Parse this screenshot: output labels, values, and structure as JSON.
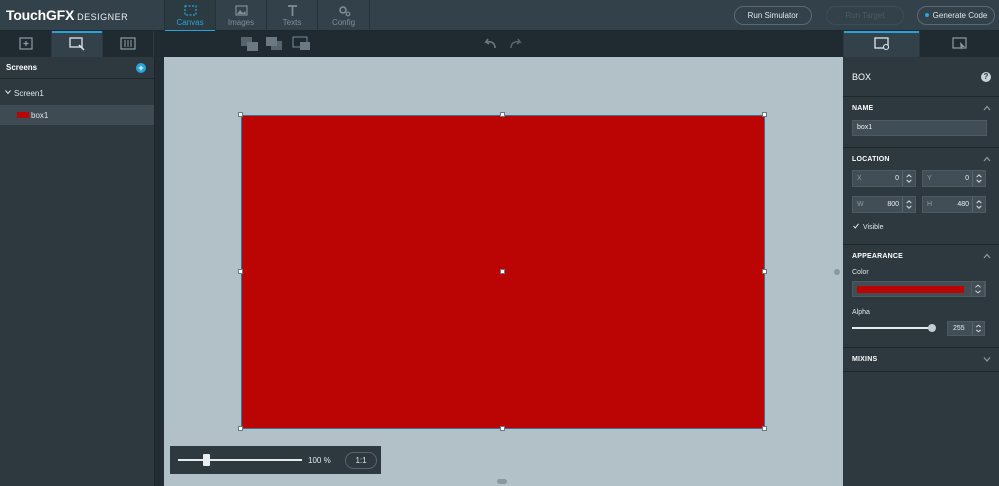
{
  "app": {
    "logo_main": "TouchGFX",
    "logo_sub": "DESIGNER"
  },
  "nav_tabs": [
    {
      "label": "Canvas",
      "icon": "canvas-icon",
      "active": true
    },
    {
      "label": "Images",
      "icon": "image-icon",
      "active": false
    },
    {
      "label": "Texts",
      "icon": "text-icon",
      "active": false
    },
    {
      "label": "Config",
      "icon": "gear-icon",
      "active": false
    }
  ],
  "toolbar": {
    "run_simulator": "Run Simulator",
    "run_target": "Run Target",
    "generate_code": "Generate Code"
  },
  "left_panel": {
    "title": "Screens",
    "screen_name": "Screen1",
    "widget_name": "box1"
  },
  "zoom": {
    "value": "100 %",
    "reset_label": "1:1",
    "level": 0.2
  },
  "properties": {
    "widget_type": "BOX",
    "name_section": "NAME",
    "name_value": "box1",
    "location_section": "LOCATION",
    "x_label": "X",
    "x_value": "0",
    "y_label": "Y",
    "y_value": "0",
    "w_label": "W",
    "w_value": "800",
    "h_label": "H",
    "h_value": "480",
    "visible_label": "Visible",
    "appearance_section": "APPEARANCE",
    "color_label": "Color",
    "color_value": "#bb0404",
    "alpha_label": "Alpha",
    "alpha_value": "255",
    "mixins_section": "MIXINS"
  },
  "colors": {
    "accent": "#29a3dc",
    "box_fill": "#bb0404",
    "canvas_bg": "#b2c1c8"
  }
}
